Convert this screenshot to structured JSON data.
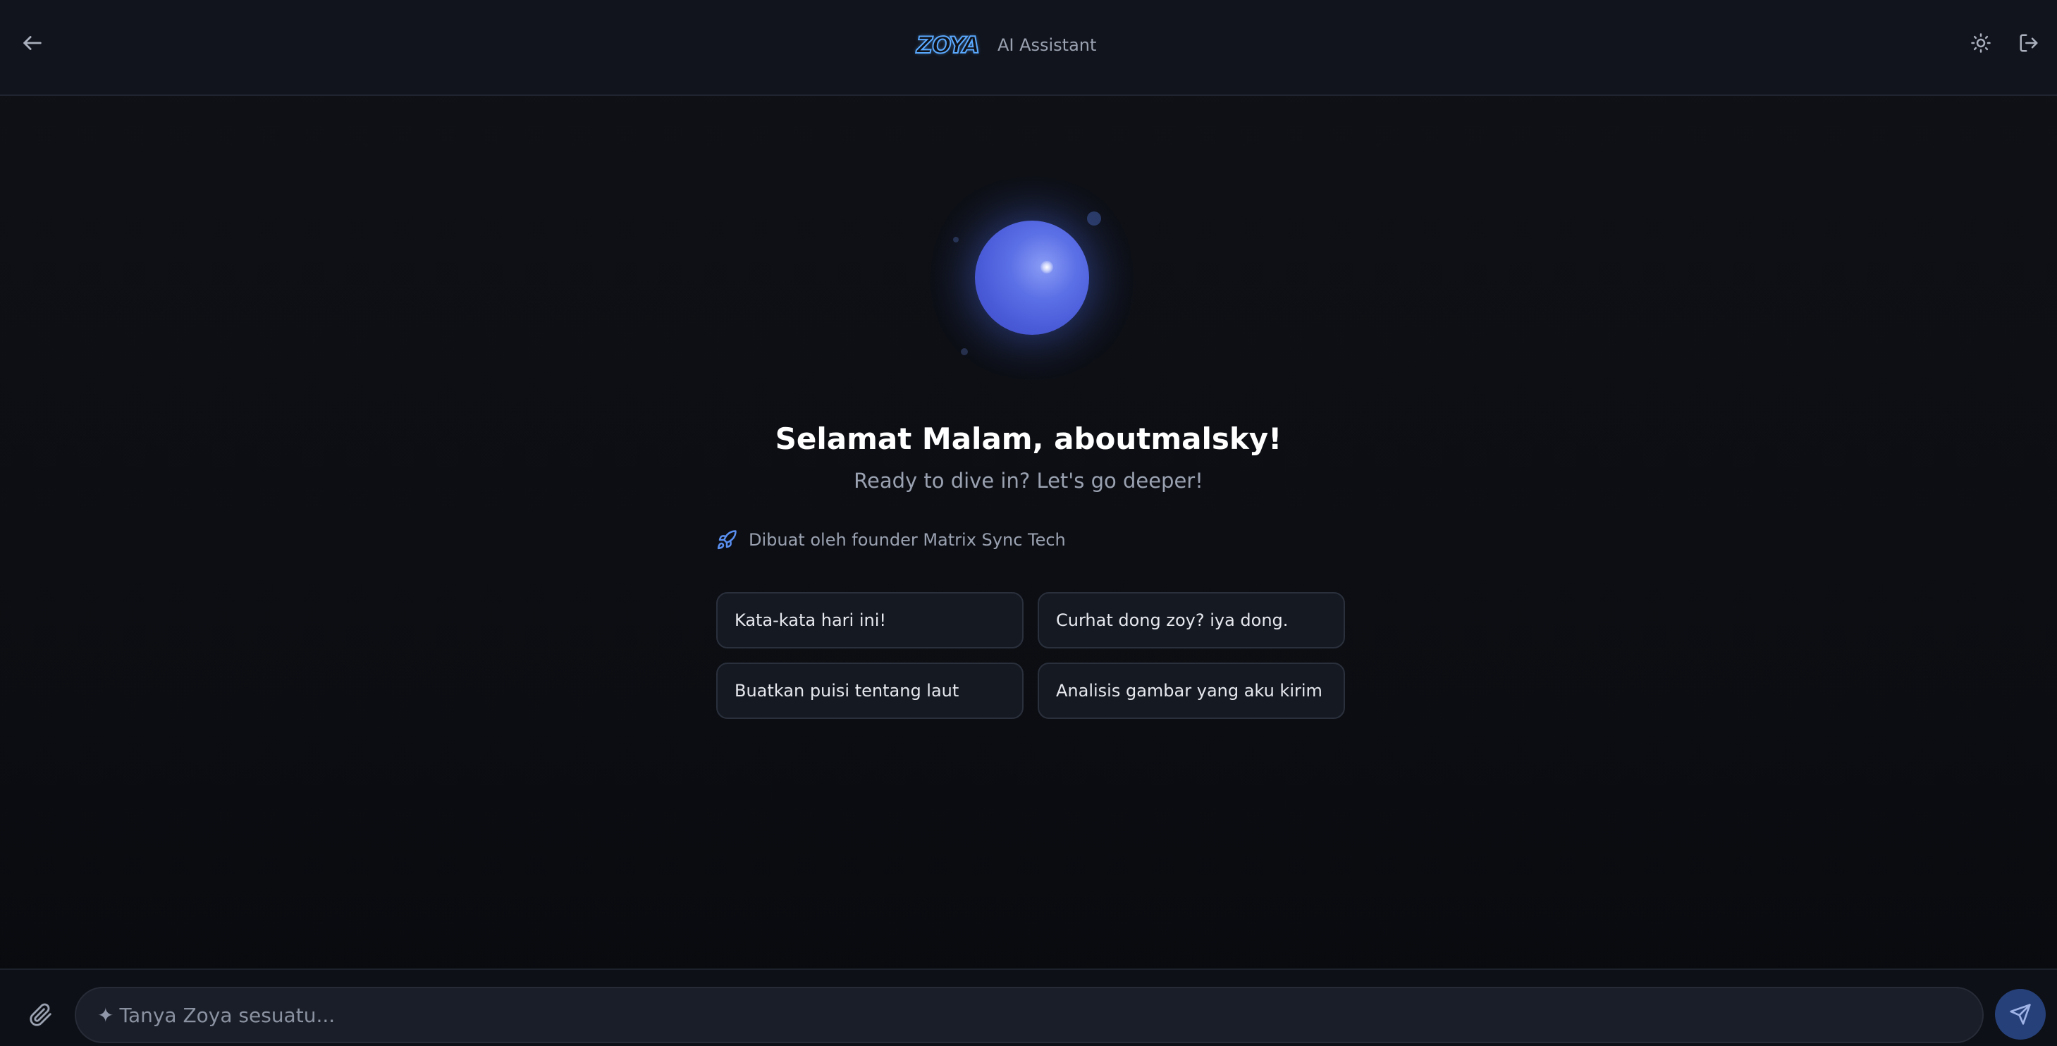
{
  "header": {
    "logo_text": "ZOYA",
    "subtitle": "AI Assistant",
    "back_icon": "arrow-left-icon",
    "theme_icon": "sun-icon",
    "logout_icon": "logout-icon"
  },
  "hero": {
    "greeting": "Selamat Malam, aboutmalsky!",
    "subtitle": "Ready to dive in? Let's go deeper!",
    "credit_icon": "rocket-icon",
    "credit_text": "Dibuat oleh founder Matrix Sync Tech"
  },
  "suggestions": [
    {
      "label": "Kata-kata hari ini!"
    },
    {
      "label": "Curhat dong zoy? iya dong."
    },
    {
      "label": "Buatkan puisi tentang laut"
    },
    {
      "label": "Analisis gambar yang aku kirim"
    }
  ],
  "composer": {
    "attach_icon": "paperclip-icon",
    "spark_glyph": "✦",
    "placeholder": "Tanya Zoya sesuatu...",
    "value": "",
    "send_icon": "send-icon"
  },
  "colors": {
    "background": "#0f1117",
    "header_bg": "#11141c",
    "accent": "#5b6fe6",
    "logo": "#5aa9ff",
    "send_button": "#26407a"
  }
}
